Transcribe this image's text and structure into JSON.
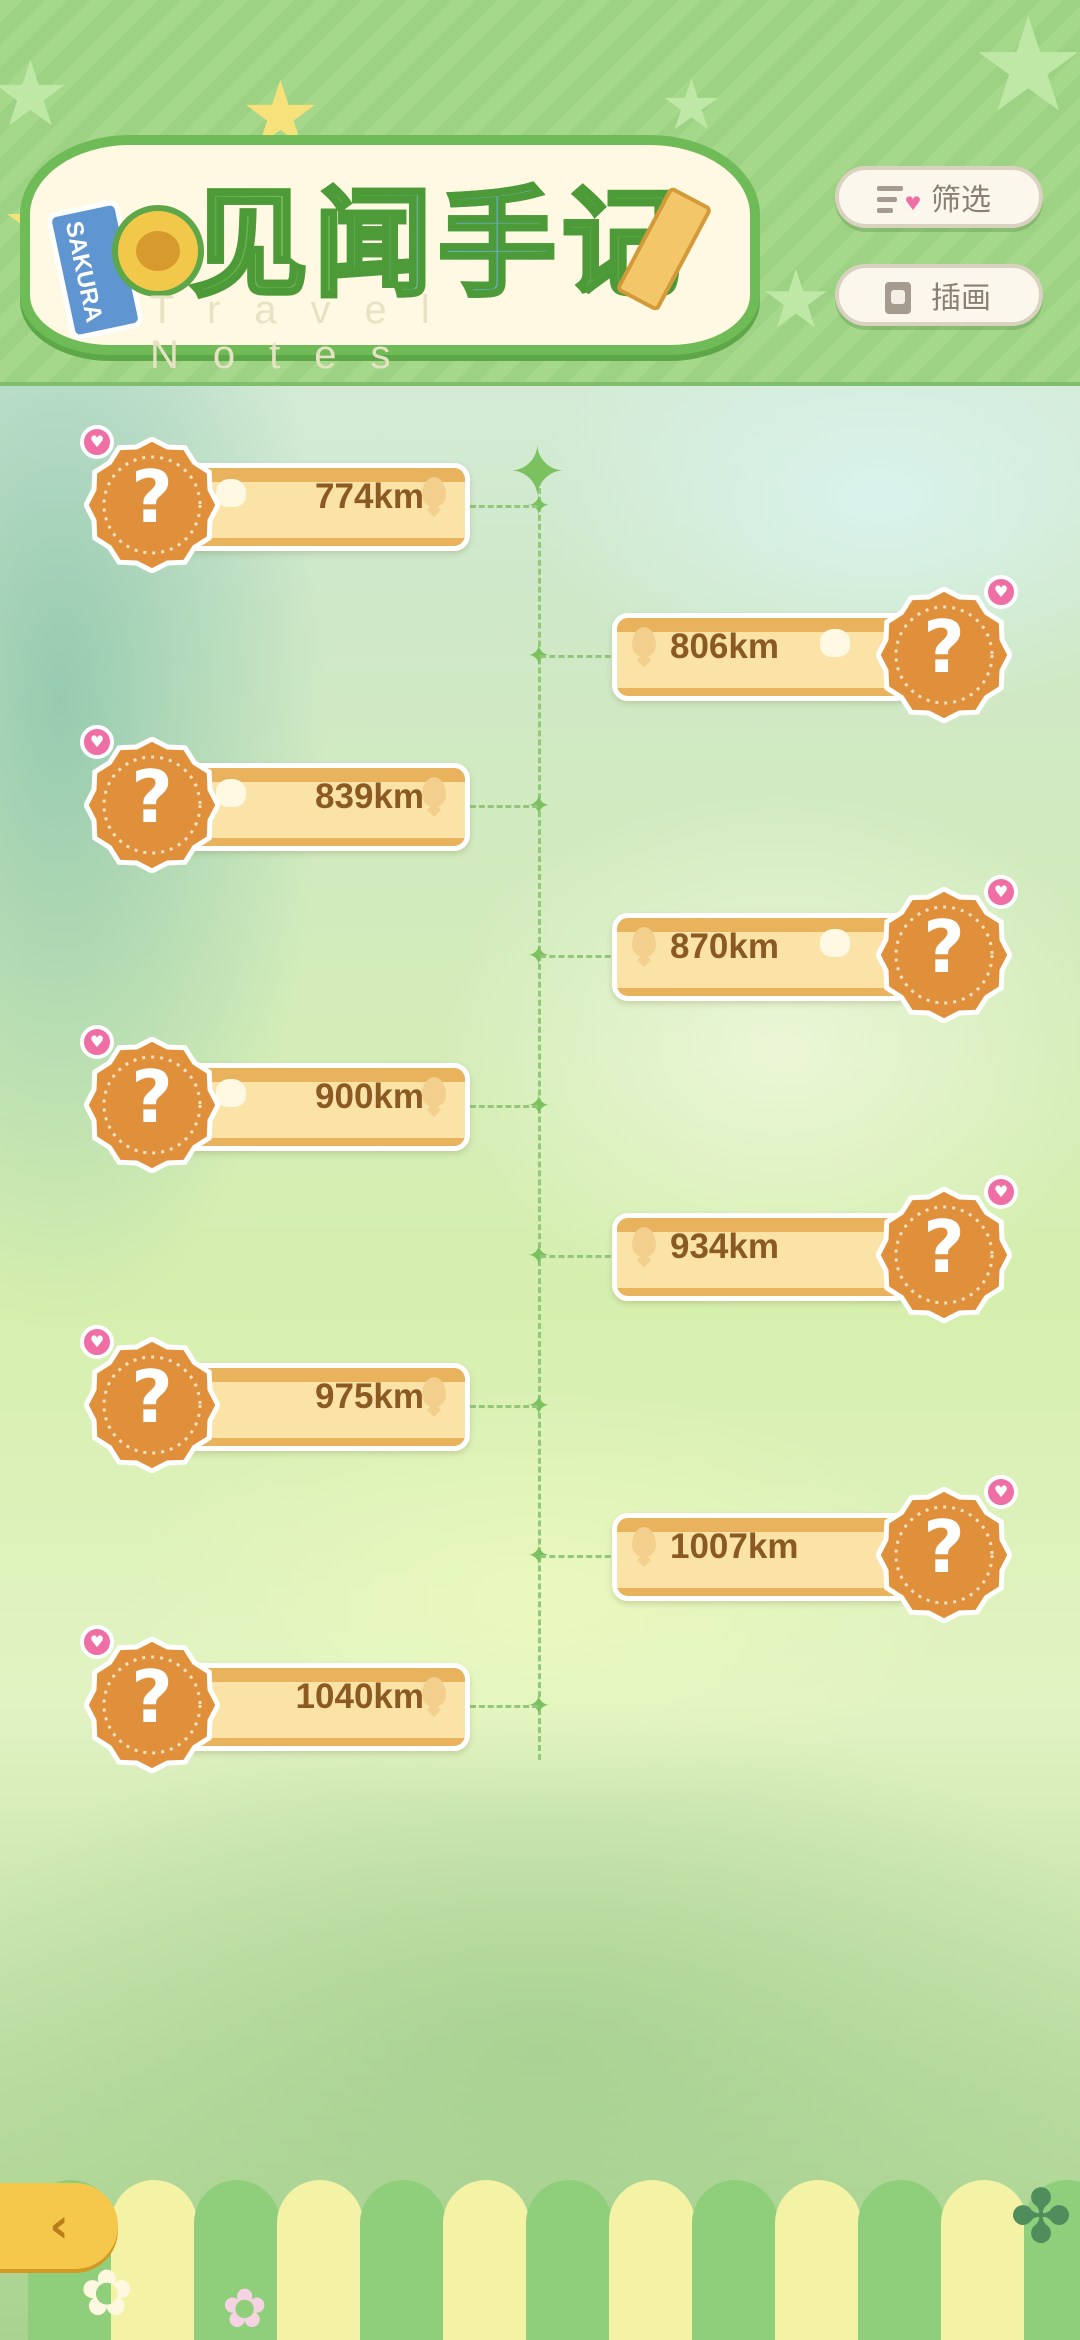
{
  "header": {
    "title": "见闻手记",
    "subtitle": "Travel Notes",
    "tag_text": "SAKURA",
    "filter_button": "筛选",
    "gallery_button": "插画"
  },
  "colors": {
    "header_green": "#a5d88a",
    "badge_orange": "#e08f3a",
    "bar_orange": "#e9b25d",
    "bar_cream": "#fbe2a6",
    "heart_pink": "#ef6fa4",
    "timeline_green": "#7cc15f",
    "back_button": "#f5c84c"
  },
  "timeline": {
    "entries": [
      {
        "distance": "774km",
        "side": "left",
        "badge_icon": "question-mark",
        "has_heart": true,
        "has_gift_icon": true
      },
      {
        "distance": "806km",
        "side": "right",
        "badge_icon": "question-mark",
        "has_heart": true,
        "has_gift_icon": true
      },
      {
        "distance": "839km",
        "side": "left",
        "badge_icon": "question-mark",
        "has_heart": true,
        "has_gift_icon": true
      },
      {
        "distance": "870km",
        "side": "right",
        "badge_icon": "question-mark",
        "has_heart": true,
        "has_gift_icon": true
      },
      {
        "distance": "900km",
        "side": "left",
        "badge_icon": "question-mark",
        "has_heart": true,
        "has_gift_icon": true
      },
      {
        "distance": "934km",
        "side": "right",
        "badge_icon": "question-mark",
        "has_heart": true,
        "has_gift_icon": false
      },
      {
        "distance": "975km",
        "side": "left",
        "badge_icon": "question-mark",
        "has_heart": true,
        "has_gift_icon": false
      },
      {
        "distance": "1007km",
        "side": "right",
        "badge_icon": "question-mark",
        "has_heart": true,
        "has_gift_icon": false
      },
      {
        "distance": "1040km",
        "side": "left",
        "badge_icon": "question-mark",
        "has_heart": true,
        "has_gift_icon": false
      }
    ]
  },
  "footer": {
    "back_icon": "back-arrow-icon"
  }
}
